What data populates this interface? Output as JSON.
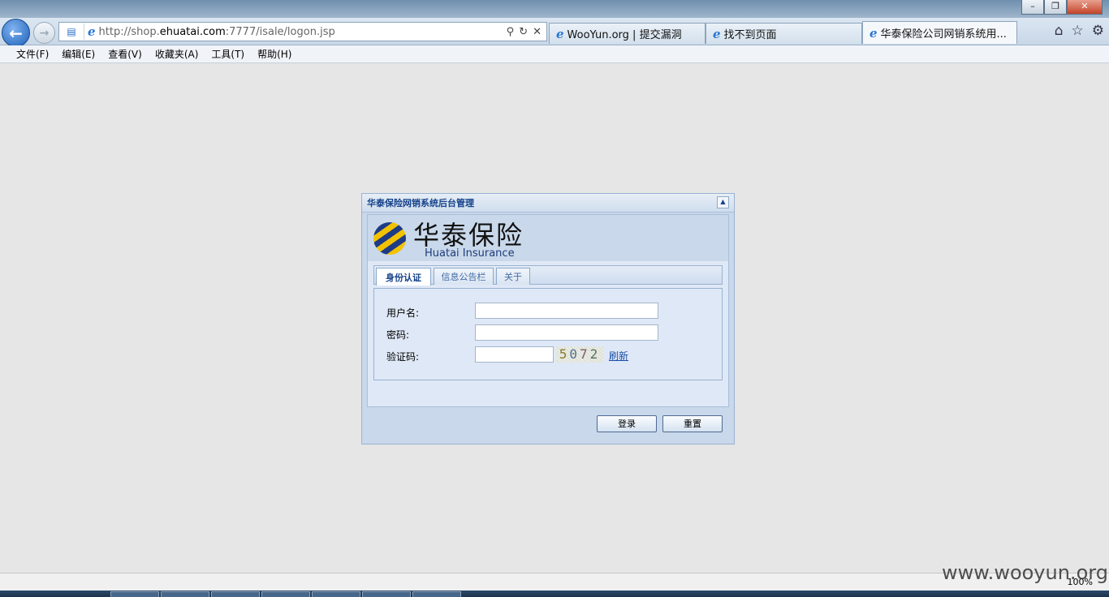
{
  "window": {
    "minimize_label": "–",
    "restore_label": "❐",
    "close_label": "✕"
  },
  "nav": {
    "back_icon": "←",
    "forward_icon": "→",
    "url_prefix": "http://shop.",
    "url_domain": "ehuatai.com",
    "url_suffix": ":7777/isale/logon.jsp",
    "search_icon": "⚲",
    "compat_icon": "▤",
    "refresh_icon": "↻",
    "stop_icon": "✕"
  },
  "tabs": [
    {
      "label": "WooYun.org | 提交漏洞",
      "active": false
    },
    {
      "label": "找不到页面",
      "active": false
    },
    {
      "label": "华泰保险公司网销系统用...",
      "active": true,
      "close": "✕"
    }
  ],
  "toolbar_icons": {
    "home": "⌂",
    "favorites": "☆",
    "tools": "⚙"
  },
  "menu": [
    "文件(F)",
    "编辑(E)",
    "查看(V)",
    "收藏夹(A)",
    "工具(T)",
    "帮助(H)"
  ],
  "panel": {
    "title": "华泰保险网销系统后台管理",
    "collapse_icon": "▲",
    "logo_cn": "华泰保险",
    "logo_en": "Huatai Insurance",
    "tabs": [
      {
        "label": "身份认证",
        "active": true
      },
      {
        "label": "信息公告栏",
        "active": false
      },
      {
        "label": "关于",
        "active": false
      }
    ],
    "form": {
      "username_label": "用户名:",
      "username_value": "",
      "password_label": "密码:",
      "password_value": "",
      "captcha_label": "验证码:",
      "captcha_value": "",
      "captcha_text": [
        "5",
        "0",
        "7",
        "2"
      ],
      "refresh_label": "刷新"
    },
    "buttons": {
      "login": "登录",
      "reset": "重置"
    }
  },
  "status": {
    "zoom": "100%"
  },
  "watermark": "www.wooyun.org",
  "colors": {
    "panel_title": "#15428b",
    "panel_bg": "#c9d8ea",
    "link": "#1c4fa8"
  }
}
